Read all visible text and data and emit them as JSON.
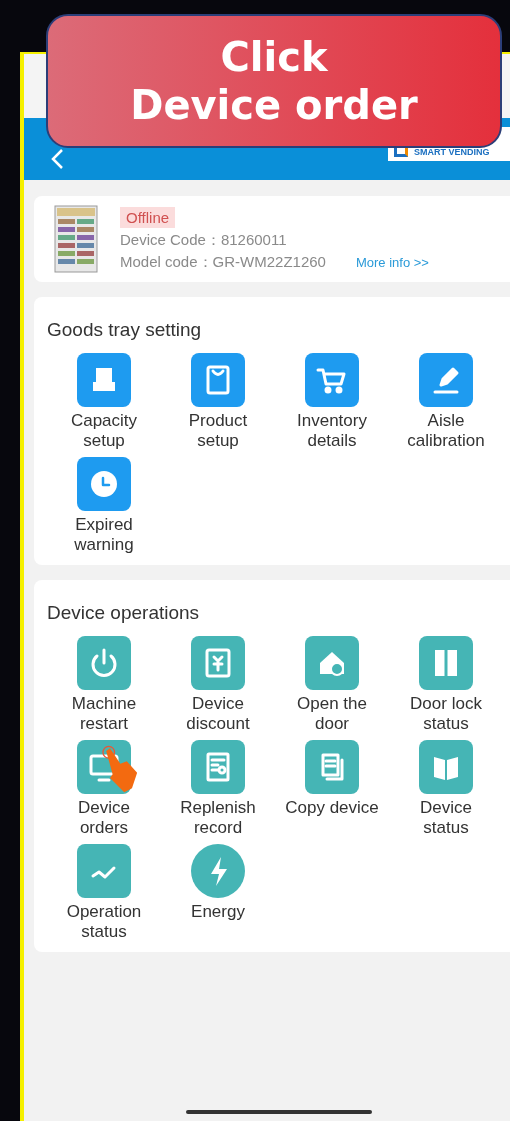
{
  "banner": {
    "lines": [
      "Click",
      "Device order"
    ]
  },
  "header": {
    "logo_text": "SMART VENDING"
  },
  "device": {
    "status": "Offline",
    "device_code_label": "Device Code：",
    "device_code": "81260011",
    "model_code_label": "Model code：",
    "model_code": "GR-WM22Z1260",
    "more_link": "More info >>"
  },
  "sections": [
    {
      "title": "Goods tray setting",
      "kind": "tray",
      "items": [
        {
          "label": "Capacity setup",
          "tapped": false
        },
        {
          "label": "Product setup",
          "tapped": false
        },
        {
          "label": "Inventory details",
          "tapped": false
        },
        {
          "label": "Aisle calibration",
          "tapped": false
        },
        {
          "label": "Expired warning",
          "tapped": false
        }
      ]
    },
    {
      "title": "Device operations",
      "kind": "ops",
      "items": [
        {
          "label": "Machine restart",
          "tapped": false
        },
        {
          "label": "Device discount",
          "tapped": false
        },
        {
          "label": "Open the door",
          "tapped": false
        },
        {
          "label": "Door lock status",
          "tapped": false
        },
        {
          "label": "Device orders",
          "tapped": true
        },
        {
          "label": "Replenish record",
          "tapped": false
        },
        {
          "label": "Copy device",
          "tapped": false
        },
        {
          "label": "Device status",
          "tapped": false
        },
        {
          "label": "Operation status",
          "tapped": false
        },
        {
          "label": "Energy",
          "tapped": false
        }
      ]
    }
  ]
}
